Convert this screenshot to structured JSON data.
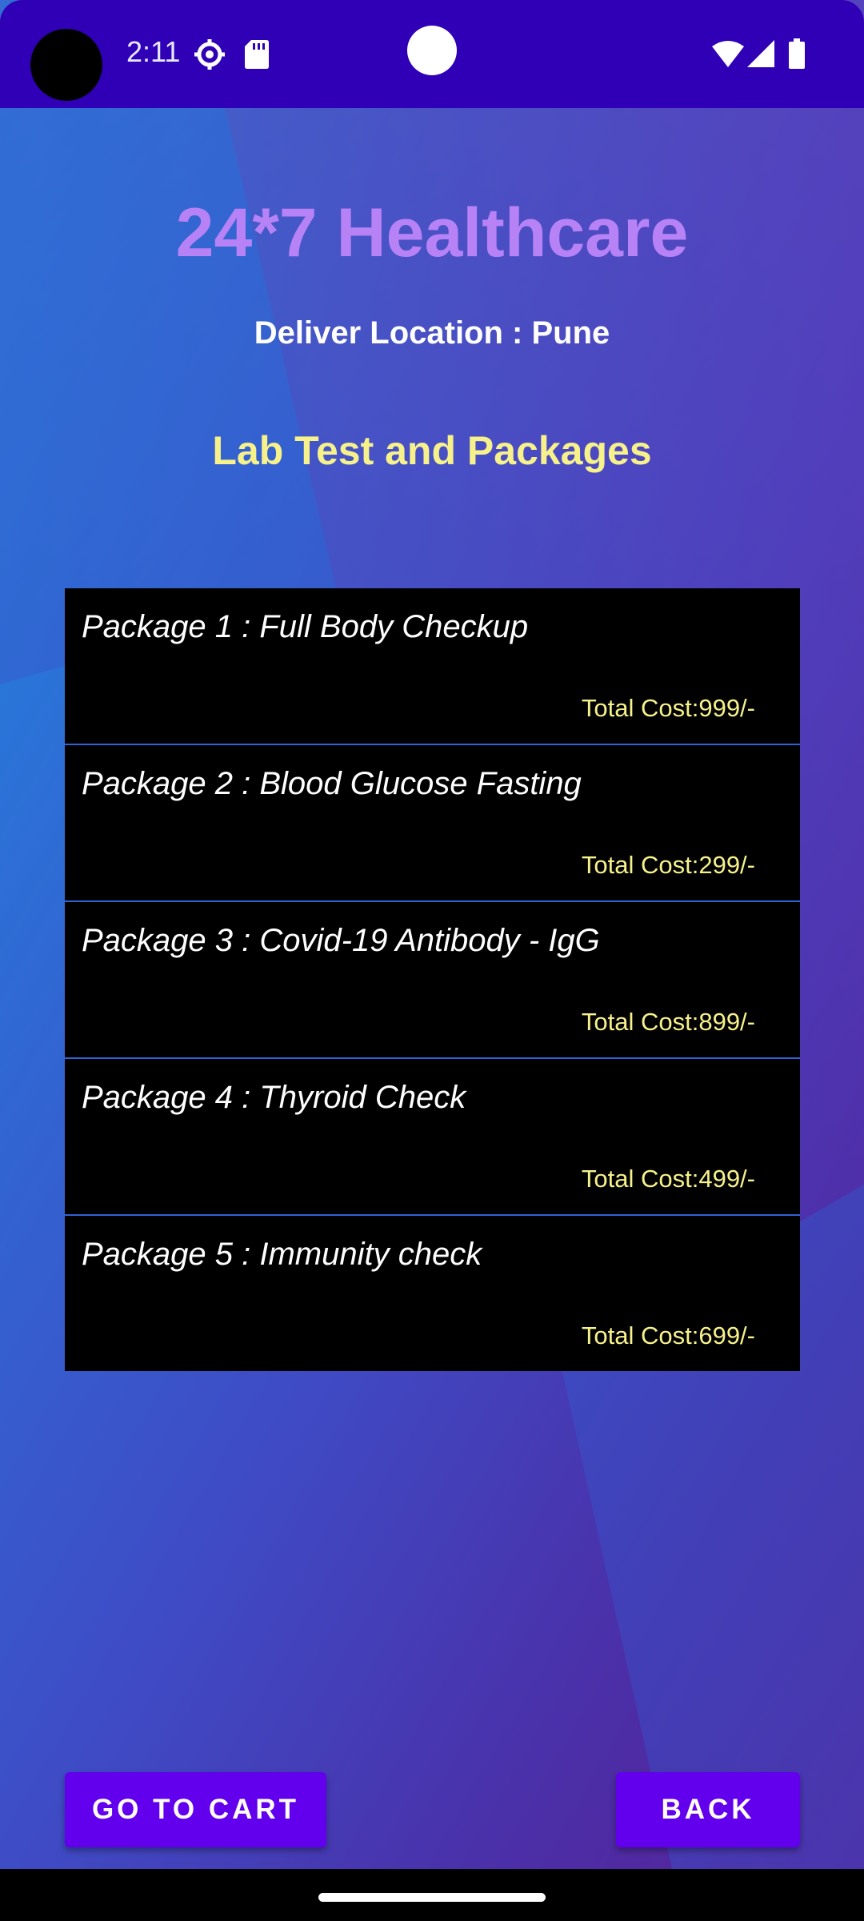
{
  "status_bar": {
    "time": "2:11",
    "icons": [
      "settings-icon",
      "sd-card-icon",
      "wifi-icon",
      "signal-icon",
      "battery-icon"
    ]
  },
  "header": {
    "app_title": "24*7 Healthcare",
    "deliver_location": "Deliver Location : Pune",
    "section_title": "Lab Test and Packages"
  },
  "packages": [
    {
      "name": "Package 1 : Full Body Checkup",
      "cost": "Total Cost:999/-"
    },
    {
      "name": "Package 2 : Blood Glucose Fasting",
      "cost": "Total Cost:299/-"
    },
    {
      "name": "Package 3 : Covid-19 Antibody - IgG",
      "cost": "Total Cost:899/-"
    },
    {
      "name": "Package 4 : Thyroid Check",
      "cost": "Total Cost:499/-"
    },
    {
      "name": "Package 5 : Immunity check",
      "cost": "Total Cost:699/-"
    }
  ],
  "buttons": {
    "go_to_cart": "GO TO CART",
    "back": "BACK"
  },
  "colors": {
    "status_bar": "#3000b6",
    "title": "#b782f5",
    "accent_yellow": "#f6f18a",
    "button": "#6200ee"
  }
}
